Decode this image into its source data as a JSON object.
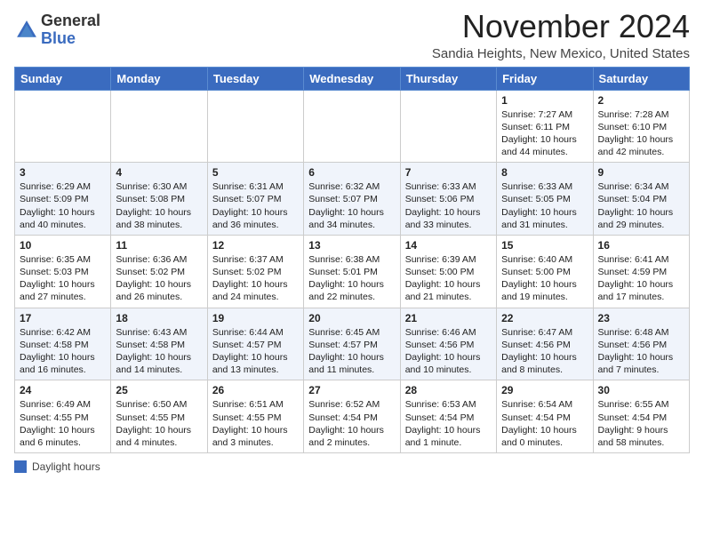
{
  "header": {
    "logo_general": "General",
    "logo_blue": "Blue",
    "month_title": "November 2024",
    "location": "Sandia Heights, New Mexico, United States"
  },
  "weekdays": [
    "Sunday",
    "Monday",
    "Tuesday",
    "Wednesday",
    "Thursday",
    "Friday",
    "Saturday"
  ],
  "weeks": [
    [
      {
        "day": "",
        "info": ""
      },
      {
        "day": "",
        "info": ""
      },
      {
        "day": "",
        "info": ""
      },
      {
        "day": "",
        "info": ""
      },
      {
        "day": "",
        "info": ""
      },
      {
        "day": "1",
        "info": "Sunrise: 7:27 AM\nSunset: 6:11 PM\nDaylight: 10 hours and 44 minutes."
      },
      {
        "day": "2",
        "info": "Sunrise: 7:28 AM\nSunset: 6:10 PM\nDaylight: 10 hours and 42 minutes."
      }
    ],
    [
      {
        "day": "3",
        "info": "Sunrise: 6:29 AM\nSunset: 5:09 PM\nDaylight: 10 hours and 40 minutes."
      },
      {
        "day": "4",
        "info": "Sunrise: 6:30 AM\nSunset: 5:08 PM\nDaylight: 10 hours and 38 minutes."
      },
      {
        "day": "5",
        "info": "Sunrise: 6:31 AM\nSunset: 5:07 PM\nDaylight: 10 hours and 36 minutes."
      },
      {
        "day": "6",
        "info": "Sunrise: 6:32 AM\nSunset: 5:07 PM\nDaylight: 10 hours and 34 minutes."
      },
      {
        "day": "7",
        "info": "Sunrise: 6:33 AM\nSunset: 5:06 PM\nDaylight: 10 hours and 33 minutes."
      },
      {
        "day": "8",
        "info": "Sunrise: 6:33 AM\nSunset: 5:05 PM\nDaylight: 10 hours and 31 minutes."
      },
      {
        "day": "9",
        "info": "Sunrise: 6:34 AM\nSunset: 5:04 PM\nDaylight: 10 hours and 29 minutes."
      }
    ],
    [
      {
        "day": "10",
        "info": "Sunrise: 6:35 AM\nSunset: 5:03 PM\nDaylight: 10 hours and 27 minutes."
      },
      {
        "day": "11",
        "info": "Sunrise: 6:36 AM\nSunset: 5:02 PM\nDaylight: 10 hours and 26 minutes."
      },
      {
        "day": "12",
        "info": "Sunrise: 6:37 AM\nSunset: 5:02 PM\nDaylight: 10 hours and 24 minutes."
      },
      {
        "day": "13",
        "info": "Sunrise: 6:38 AM\nSunset: 5:01 PM\nDaylight: 10 hours and 22 minutes."
      },
      {
        "day": "14",
        "info": "Sunrise: 6:39 AM\nSunset: 5:00 PM\nDaylight: 10 hours and 21 minutes."
      },
      {
        "day": "15",
        "info": "Sunrise: 6:40 AM\nSunset: 5:00 PM\nDaylight: 10 hours and 19 minutes."
      },
      {
        "day": "16",
        "info": "Sunrise: 6:41 AM\nSunset: 4:59 PM\nDaylight: 10 hours and 17 minutes."
      }
    ],
    [
      {
        "day": "17",
        "info": "Sunrise: 6:42 AM\nSunset: 4:58 PM\nDaylight: 10 hours and 16 minutes."
      },
      {
        "day": "18",
        "info": "Sunrise: 6:43 AM\nSunset: 4:58 PM\nDaylight: 10 hours and 14 minutes."
      },
      {
        "day": "19",
        "info": "Sunrise: 6:44 AM\nSunset: 4:57 PM\nDaylight: 10 hours and 13 minutes."
      },
      {
        "day": "20",
        "info": "Sunrise: 6:45 AM\nSunset: 4:57 PM\nDaylight: 10 hours and 11 minutes."
      },
      {
        "day": "21",
        "info": "Sunrise: 6:46 AM\nSunset: 4:56 PM\nDaylight: 10 hours and 10 minutes."
      },
      {
        "day": "22",
        "info": "Sunrise: 6:47 AM\nSunset: 4:56 PM\nDaylight: 10 hours and 8 minutes."
      },
      {
        "day": "23",
        "info": "Sunrise: 6:48 AM\nSunset: 4:56 PM\nDaylight: 10 hours and 7 minutes."
      }
    ],
    [
      {
        "day": "24",
        "info": "Sunrise: 6:49 AM\nSunset: 4:55 PM\nDaylight: 10 hours and 6 minutes."
      },
      {
        "day": "25",
        "info": "Sunrise: 6:50 AM\nSunset: 4:55 PM\nDaylight: 10 hours and 4 minutes."
      },
      {
        "day": "26",
        "info": "Sunrise: 6:51 AM\nSunset: 4:55 PM\nDaylight: 10 hours and 3 minutes."
      },
      {
        "day": "27",
        "info": "Sunrise: 6:52 AM\nSunset: 4:54 PM\nDaylight: 10 hours and 2 minutes."
      },
      {
        "day": "28",
        "info": "Sunrise: 6:53 AM\nSunset: 4:54 PM\nDaylight: 10 hours and 1 minute."
      },
      {
        "day": "29",
        "info": "Sunrise: 6:54 AM\nSunset: 4:54 PM\nDaylight: 10 hours and 0 minutes."
      },
      {
        "day": "30",
        "info": "Sunrise: 6:55 AM\nSunset: 4:54 PM\nDaylight: 9 hours and 58 minutes."
      }
    ]
  ],
  "footer": {
    "legend_label": "Daylight hours"
  }
}
